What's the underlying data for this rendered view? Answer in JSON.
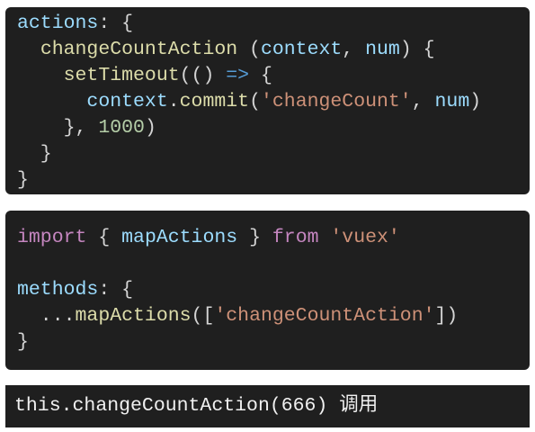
{
  "blocks": [
    {
      "lines": [
        [
          [
            "actions",
            "k"
          ],
          [
            ": {",
            "p"
          ]
        ],
        [
          [
            "  ",
            "p"
          ],
          [
            "changeCountAction",
            "f"
          ],
          [
            " (",
            "p"
          ],
          [
            "context",
            "k"
          ],
          [
            ", ",
            "p"
          ],
          [
            "num",
            "k"
          ],
          [
            ") {",
            "p"
          ]
        ],
        [
          [
            "    ",
            "p"
          ],
          [
            "setTimeout",
            "f"
          ],
          [
            "(() ",
            "p"
          ],
          [
            "=>",
            "op"
          ],
          [
            " {",
            "p"
          ]
        ],
        [
          [
            "      ",
            "p"
          ],
          [
            "context",
            "k"
          ],
          [
            ".",
            "p"
          ],
          [
            "commit",
            "f"
          ],
          [
            "(",
            "p"
          ],
          [
            "'changeCount'",
            "s"
          ],
          [
            ", ",
            "p"
          ],
          [
            "num",
            "k"
          ],
          [
            ")",
            "p"
          ]
        ],
        [
          [
            "    }, ",
            "p"
          ],
          [
            "1000",
            "n"
          ],
          [
            ")",
            "p"
          ]
        ],
        [
          [
            "  }",
            "p"
          ]
        ],
        [
          [
            "}",
            "p"
          ]
        ]
      ]
    },
    {
      "lines": [
        [
          [
            "import",
            "kw"
          ],
          [
            " { ",
            "p"
          ],
          [
            "mapActions",
            "k"
          ],
          [
            " } ",
            "p"
          ],
          [
            "from",
            "kw"
          ],
          [
            " ",
            "p"
          ],
          [
            "'vuex'",
            "s"
          ]
        ],
        [
          [
            "",
            "p"
          ]
        ],
        [
          [
            "methods",
            "k"
          ],
          [
            ": {",
            "p"
          ]
        ],
        [
          [
            "  ...",
            "p"
          ],
          [
            "mapActions",
            "f"
          ],
          [
            "([",
            "p"
          ],
          [
            "'changeCountAction'",
            "s"
          ],
          [
            "])",
            "p"
          ]
        ],
        [
          [
            "}",
            "p"
          ]
        ]
      ]
    },
    {
      "lines": [
        [
          [
            "this.changeCountAction(666) 调用",
            "w"
          ]
        ]
      ]
    }
  ]
}
